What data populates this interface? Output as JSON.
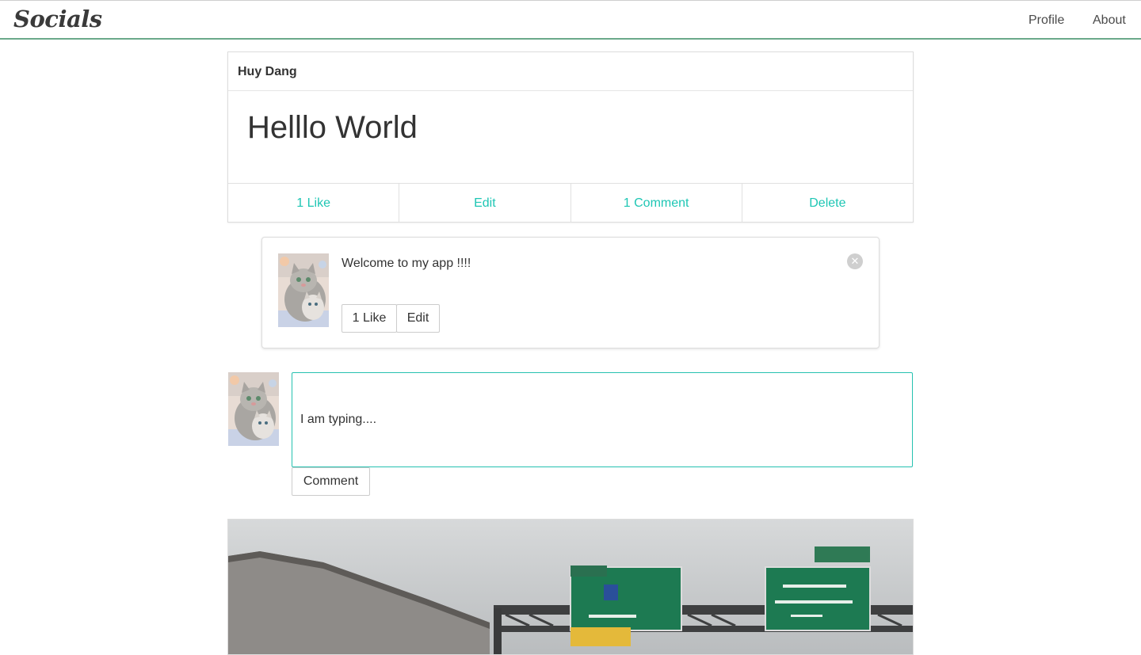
{
  "navbar": {
    "brand": "Socials",
    "links": [
      {
        "label": "Profile"
      },
      {
        "label": "About"
      }
    ]
  },
  "post": {
    "author": "Huy Dang",
    "title": "Helllo World",
    "actions": {
      "like": "1 Like",
      "edit": "Edit",
      "comment": "1 Comment",
      "delete": "Delete"
    }
  },
  "comment": {
    "text": "Welcome to my app !!!!",
    "like_label": "1 Like",
    "edit_label": "Edit"
  },
  "compose": {
    "value": "I am typing....",
    "submit_label": "Comment"
  },
  "colors": {
    "accent": "#1ec6b4",
    "navbar_border": "#6aa98a",
    "sign_green": "#1d7a52"
  },
  "icons": {
    "close": "close-icon"
  }
}
